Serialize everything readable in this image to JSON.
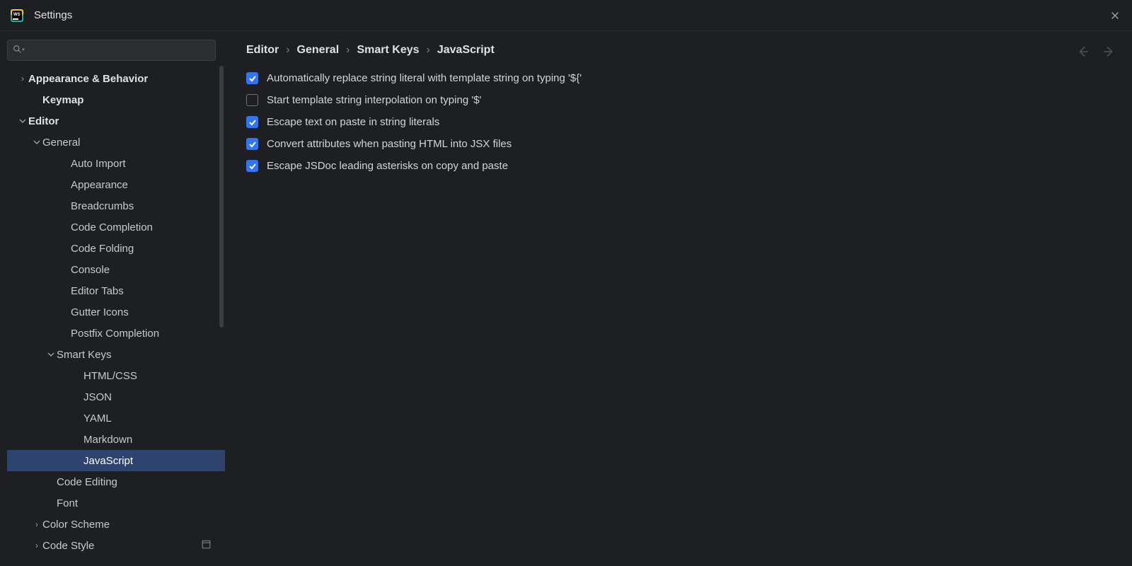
{
  "titlebar": {
    "title": "Settings"
  },
  "search": {
    "placeholder": ""
  },
  "tree": {
    "appearance_behavior": "Appearance & Behavior",
    "keymap": "Keymap",
    "editor": "Editor",
    "general": "General",
    "auto_import": "Auto Import",
    "appearance": "Appearance",
    "breadcrumbs": "Breadcrumbs",
    "code_completion": "Code Completion",
    "code_folding": "Code Folding",
    "console": "Console",
    "editor_tabs": "Editor Tabs",
    "gutter_icons": "Gutter Icons",
    "postfix_completion": "Postfix Completion",
    "smart_keys": "Smart Keys",
    "html_css": "HTML/CSS",
    "json": "JSON",
    "yaml": "YAML",
    "markdown": "Markdown",
    "javascript": "JavaScript",
    "code_editing": "Code Editing",
    "font": "Font",
    "color_scheme": "Color Scheme",
    "code_style": "Code Style"
  },
  "breadcrumb": {
    "p0": "Editor",
    "p1": "General",
    "p2": "Smart Keys",
    "p3": "JavaScript",
    "sep": "›"
  },
  "options": [
    {
      "checked": true,
      "label": "Automatically replace string literal with template string on typing '${'"
    },
    {
      "checked": false,
      "label": "Start template string interpolation on typing '$'"
    },
    {
      "checked": true,
      "label": "Escape text on paste in string literals"
    },
    {
      "checked": true,
      "label": "Convert attributes when pasting HTML into JSX files"
    },
    {
      "checked": true,
      "label": "Escape JSDoc leading asterisks on copy and paste"
    }
  ]
}
